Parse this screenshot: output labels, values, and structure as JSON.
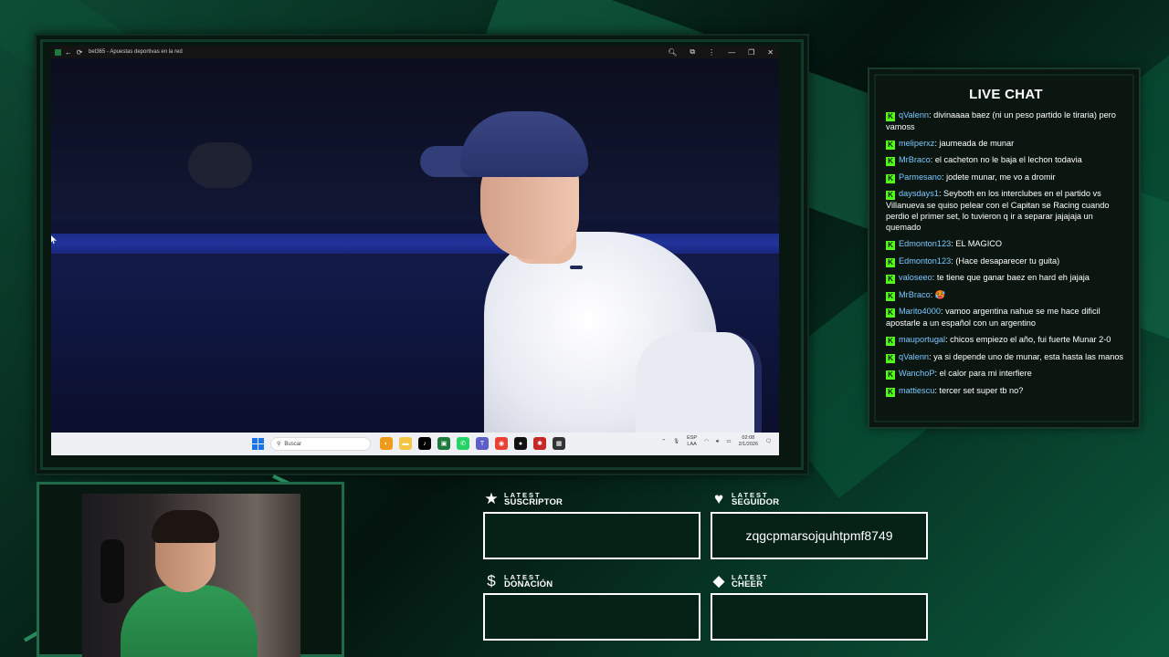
{
  "browser": {
    "title": "bet365 - Apuestas deportivas en la red"
  },
  "taskbar": {
    "search_placeholder": "Buscar",
    "lang_top": "ESP",
    "lang_bottom": "LAA",
    "time": "02:08",
    "date": "2/1/2026"
  },
  "chat": {
    "title": "LIVE CHAT",
    "messages": [
      {
        "user": "qValenn",
        "text": ": divinaaaa baez (ni un peso partido le tiraria) pero vamoss"
      },
      {
        "user": "meliperxz",
        "text": ": jaumeada de munar"
      },
      {
        "user": "MrBraco",
        "text": ": el cacheton no le baja el lechon todavia"
      },
      {
        "user": "Parmesano",
        "text": ": jodete munar, me vo a dromir"
      },
      {
        "user": "daysdays1",
        "text": ": Seyboth en los interclubes en el partido vs Villanueva se quiso pelear con el Capitan se Racing cuando perdio el primer set, lo tuvieron q ir a separar jajajaja un quemado"
      },
      {
        "user": "Edmonton123",
        "text": ": EL MAGICO"
      },
      {
        "user": "Edmonton123",
        "text": ": (Hace desaparecer tu guita)"
      },
      {
        "user": "valoseeo",
        "text": ": te tiene que ganar baez en hard eh jajaja"
      },
      {
        "user": "MrBraco",
        "text": ": 🥵"
      },
      {
        "user": "Marito4000",
        "text": ": vamoo argentina nahue se me hace dificil apostarle a un español con un argentino"
      },
      {
        "user": "mauportugal",
        "text": ": chicos empiezo el año, fui fuerte Munar 2-0"
      },
      {
        "user": "qValenn",
        "text": ": ya si depende uno de munar, esta hasta las manos"
      },
      {
        "user": "WanchoP",
        "text": ": el calor para mi interfiere"
      },
      {
        "user": "mattiescu",
        "text": ": tercer set super tb no?"
      }
    ]
  },
  "widgets": {
    "suscriptor": {
      "small": "LATEST",
      "big": "SUSCRIPTOR",
      "value": "",
      "icon": "star-icon"
    },
    "seguidor": {
      "small": "LATEST",
      "big": "SEGUIDOR",
      "value": "zqgcpmarsojquhtpmf8749",
      "icon": "heart-icon"
    },
    "donacion": {
      "small": "LATEST",
      "big": "DONACIÓN",
      "value": "",
      "icon": "dollar-icon"
    },
    "cheer": {
      "small": "LATEST",
      "big": "CHEER",
      "value": "",
      "icon": "diamond-icon"
    }
  },
  "colors": {
    "kick_green": "#53fc18",
    "panel_bg": "#0b1611",
    "accent": "#1d6b48"
  }
}
